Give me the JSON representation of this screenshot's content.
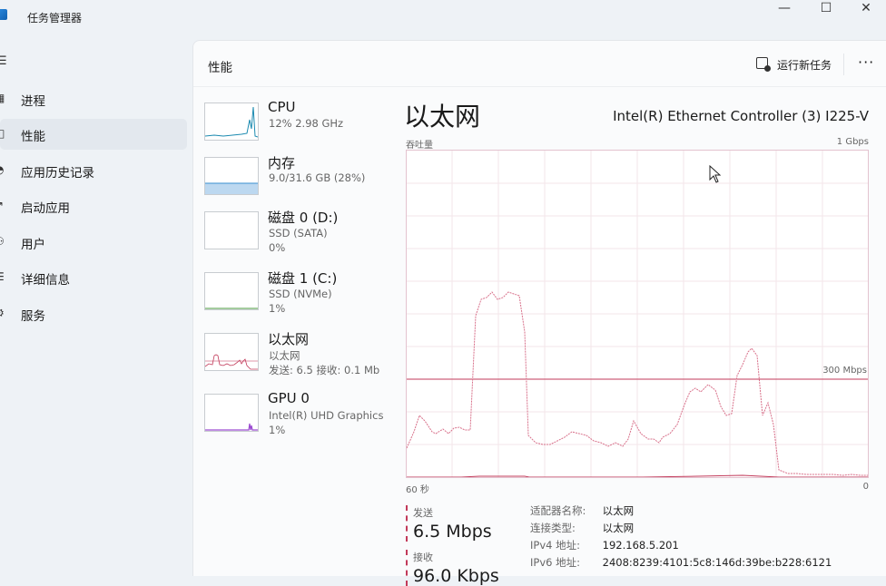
{
  "window": {
    "title": "任务管理器",
    "minimize": "—",
    "maximize": "☐",
    "close": "✕"
  },
  "sidebar": {
    "items": [
      {
        "label": "进程",
        "icon": "grid-icon"
      },
      {
        "label": "性能",
        "icon": "performance-icon"
      },
      {
        "label": "应用历史记录",
        "icon": "history-icon"
      },
      {
        "label": "启动应用",
        "icon": "startup-icon"
      },
      {
        "label": "用户",
        "icon": "users-icon"
      },
      {
        "label": "详细信息",
        "icon": "details-icon"
      },
      {
        "label": "服务",
        "icon": "services-icon"
      }
    ],
    "active_index": 1
  },
  "header": {
    "title": "性能",
    "run_task_label": "运行新任务",
    "more_label": "···"
  },
  "devices": [
    {
      "name": "CPU",
      "sub1": "12% 2.98 GHz",
      "sub2": "",
      "sub3": "",
      "color": "#1b8ab0"
    },
    {
      "name": "内存",
      "sub1": "9.0/31.6 GB (28%)",
      "sub2": "",
      "sub3": "",
      "color": "#3a8fd0"
    },
    {
      "name": "磁盘 0 (D:)",
      "sub1": "SSD (SATA)",
      "sub2": "0%",
      "sub3": "",
      "color": "#4a9a3c"
    },
    {
      "name": "磁盘 1 (C:)",
      "sub1": "SSD (NVMe)",
      "sub2": "1%",
      "sub3": "",
      "color": "#4a9a3c"
    },
    {
      "name": "以太网",
      "sub1": "以太网",
      "sub2": "发送: 6.5 接收: 0.1 Mb",
      "sub3": "",
      "color": "#c23a5a"
    },
    {
      "name": "GPU 0",
      "sub1": "Intel(R) UHD Graphics",
      "sub2": "1%",
      "sub3": "",
      "color": "#9a4ad0"
    }
  ],
  "detail": {
    "title": "以太网",
    "adapter": "Intel(R) Ethernet Controller (3) I225-V",
    "throughput_label": "吞吐量",
    "max_label": "1 Gbps",
    "mid_label": "300 Mbps",
    "time_left": "60 秒",
    "time_right": "0",
    "send_label": "发送",
    "send_value": "6.5 Mbps",
    "recv_label": "接收",
    "recv_value": "96.0 Kbps",
    "graph_color": "#c23a5a",
    "properties": [
      {
        "key": "适配器名称:",
        "value": "以太网"
      },
      {
        "key": "连接类型:",
        "value": "以太网"
      },
      {
        "key": "IPv4 地址:",
        "value": "192.168.5.201"
      },
      {
        "key": "IPv6 地址:",
        "value": "2408:8239:4101:5c8:146d:39be:b228:6121"
      }
    ]
  }
}
